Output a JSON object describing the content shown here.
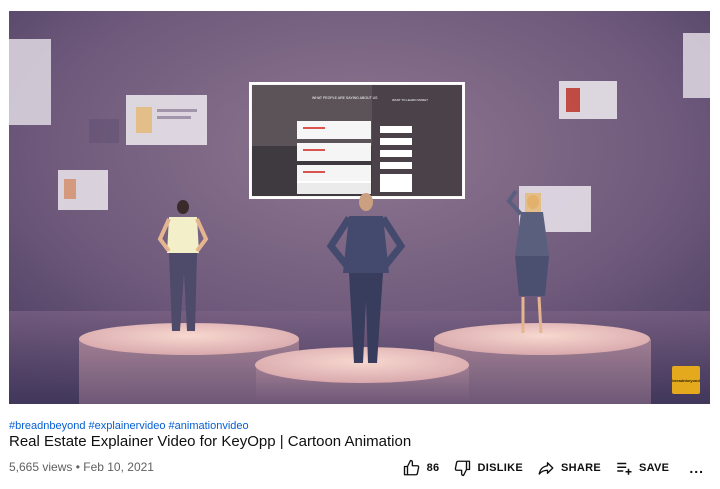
{
  "video": {
    "screen_headline": "WHAT PEOPLE ARE SAYING ABOUT US",
    "screen_form_heading": "WANT TO LEARN MORE?",
    "badge_text": "breadnbeyond"
  },
  "hashtags": [
    "#breadnbeyond",
    "#explainervideo",
    "#animationvideo"
  ],
  "title": "Real Estate Explainer Video for KeyOpp | Cartoon Animation",
  "meta": {
    "views": "5,665 views",
    "separator": " • ",
    "date": "Feb 10, 2021"
  },
  "actions": {
    "like_count": "86",
    "dislike_label": "DISLIKE",
    "share_label": "SHARE",
    "save_label": "SAVE",
    "more_label": "..."
  },
  "colors": {
    "link": "#065fd4",
    "meta": "#606060",
    "badge": "#e4a91c"
  }
}
